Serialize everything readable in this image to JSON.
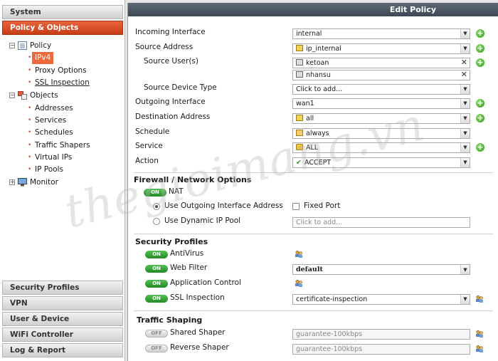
{
  "nav": {
    "system": "System",
    "policy_objects": "Policy & Objects",
    "tree": {
      "policy": "Policy",
      "ipv4": "IPv4",
      "proxy_options": "Proxy Options",
      "ssl_inspection": "SSL Inspection",
      "objects": "Objects",
      "addresses": "Addresses",
      "services": "Services",
      "schedules": "Schedules",
      "traffic_shapers": "Traffic Shapers",
      "virtual_ips": "Virtual IPs",
      "ip_pools": "IP Pools",
      "monitor": "Monitor"
    },
    "bottom": [
      "Security Profiles",
      "VPN",
      "User & Device",
      "WiFi Controller",
      "Log & Report"
    ]
  },
  "panel": {
    "title": "Edit Policy",
    "fields": {
      "incoming_interface": {
        "label": "Incoming Interface",
        "value": "internal"
      },
      "source_address": {
        "label": "Source Address",
        "value": "ip_internal"
      },
      "source_users": {
        "label": "Source User(s)",
        "values": [
          "ketoan",
          "nhansu"
        ]
      },
      "source_device_type": {
        "label": "Source Device Type",
        "placeholder": "Click to add..."
      },
      "outgoing_interface": {
        "label": "Outgoing Interface",
        "value": "wan1"
      },
      "destination_address": {
        "label": "Destination Address",
        "value": "all"
      },
      "schedule": {
        "label": "Schedule",
        "value": "always"
      },
      "service": {
        "label": "Service",
        "value": "ALL"
      },
      "action": {
        "label": "Action",
        "value": "ACCEPT"
      }
    },
    "firewall": {
      "title": "Firewall / Network Options",
      "nat_label": "NAT",
      "use_outgoing": "Use Outgoing Interface Address",
      "fixed_port": "Fixed Port",
      "use_dynamic": "Use Dynamic IP Pool",
      "dynamic_placeholder": "Click to add..."
    },
    "security": {
      "title": "Security Profiles",
      "antivirus": "AntiVirus",
      "web_filter": "Web Filter",
      "web_filter_value": "default",
      "app_control": "Application Control",
      "ssl_inspection": "SSL Inspection",
      "ssl_value": "certificate-inspection"
    },
    "shaping": {
      "title": "Traffic Shaping",
      "shared": "Shared Shaper",
      "reverse": "Reverse Shaper",
      "shared_placeholder": "guarantee-100kbps",
      "reverse_placeholder": "guarantee-100kbps"
    },
    "toggle_on": "ON",
    "toggle_off": "OFF"
  },
  "watermark": "thegioimang.vn"
}
